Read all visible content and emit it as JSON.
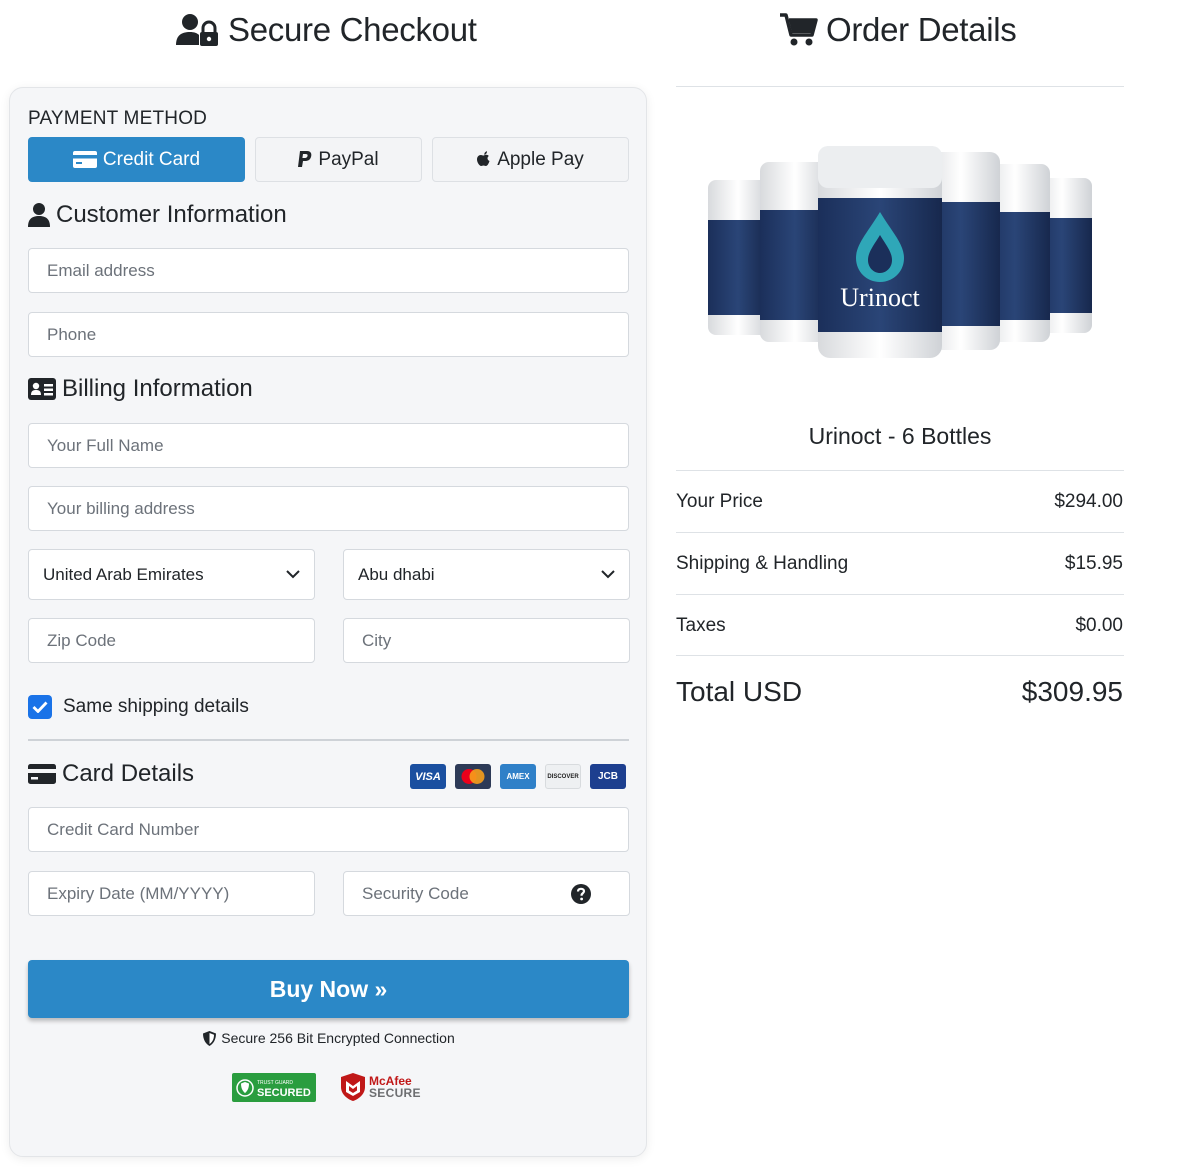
{
  "checkout": {
    "title": "Secure Checkout",
    "payment_method_label": "PAYMENT METHOD",
    "tabs": [
      {
        "label": "Credit Card",
        "active": true
      },
      {
        "label": "PayPal",
        "active": false
      },
      {
        "label": "Apple Pay",
        "active": false
      }
    ],
    "customer_title": "Customer Information",
    "email_placeholder": "Email address",
    "phone_placeholder": "Phone",
    "billing_title": "Billing Information",
    "fullname_placeholder": "Your Full Name",
    "address_placeholder": "Your billing address",
    "country_value": "United Arab Emirates",
    "state_value": "Abu dhabi",
    "zip_placeholder": "Zip Code",
    "city_placeholder": "City",
    "same_shipping_label": "Same shipping details",
    "same_shipping_checked": true,
    "card_title": "Card Details",
    "card_logos": [
      "VISA",
      "mastercard",
      "AMEX",
      "DISCOVER",
      "JCB"
    ],
    "card_number_placeholder": "Credit Card Number",
    "expiry_placeholder": "Expiry Date (MM/YYYY)",
    "cvv_placeholder": "Security Code",
    "buy_button": "Buy Now »",
    "secure_text": "Secure 256 Bit Encrypted Connection",
    "trust_badge_text": "SECURED",
    "trust_badge_small": "TRUST GUARD",
    "mcafee_line1": "McAfee",
    "mcafee_line2": "SECURE",
    "accent_color": "#2b88c7"
  },
  "order": {
    "title": "Order Details",
    "product_name": "Urinoct - 6 Bottles",
    "bottle_label": "Urinoct",
    "rows": [
      {
        "label": "Your Price",
        "value": "$294.00"
      },
      {
        "label": "Shipping & Handling",
        "value": "$15.95"
      },
      {
        "label": "Taxes",
        "value": "$0.00"
      }
    ],
    "total_label": "Total USD",
    "total_value": "$309.95"
  }
}
